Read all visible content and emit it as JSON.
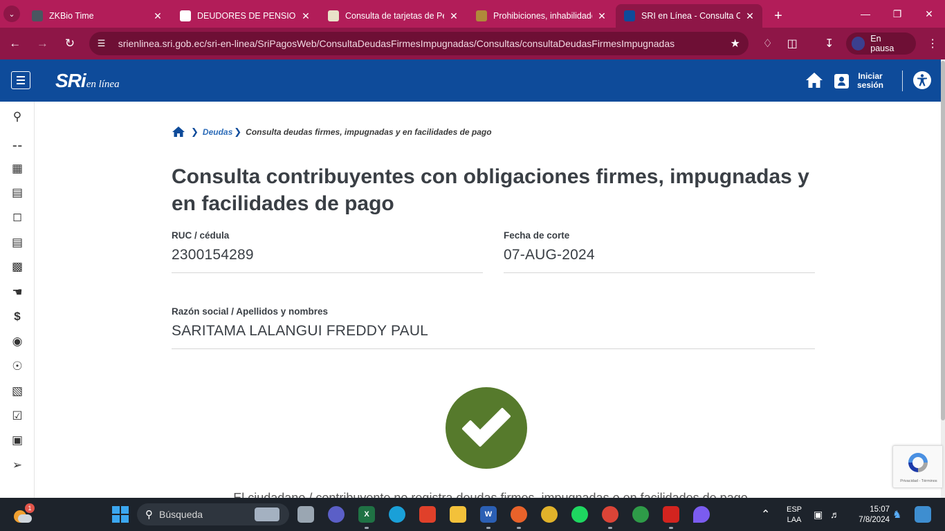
{
  "browser": {
    "tabs": [
      {
        "title": "ZKBio Time",
        "favicon": "zkbio-favicon",
        "color": "#4a5660",
        "active": false
      },
      {
        "title": "DEUDORES DE PENSIONES A",
        "favicon": "google-favicon",
        "color": "#ffffff",
        "active": false
      },
      {
        "title": "Consulta de tarjetas de Pens",
        "favicon": "gov-favicon",
        "color": "#e9e2c8",
        "active": false
      },
      {
        "title": "Prohibiciones, inhabilidades",
        "favicon": "seal-favicon",
        "color": "#b08a3a",
        "active": false
      },
      {
        "title": "SRI en Línea - Consulta Cont",
        "favicon": "sri-favicon",
        "color": "#0e4b9a",
        "active": true
      }
    ],
    "url": "srienlinea.sri.gob.ec/sri-en-linea/SriPagosWeb/ConsultaDeudasFirmesImpugnadas/Consultas/consultaDeudasFirmesImpugnadas",
    "profile_label": "En pausa"
  },
  "site": {
    "logo_main": "SRi",
    "logo_sub": "en línea",
    "login_label": "Iniciar sesión",
    "colors": {
      "header": "#0e4b9a",
      "success": "#567a2c"
    }
  },
  "breadcrumb": {
    "items": [
      "Deudas",
      "Consulta deudas firmes, impugnadas y en facilidades de pago"
    ]
  },
  "page": {
    "title": "Consulta contribuyentes con obligaciones firmes, impugnadas y en facilidades de pago",
    "fields": {
      "ruc": {
        "label": "RUC / cédula",
        "value": "2300154289"
      },
      "fecha": {
        "label": "Fecha de corte",
        "value": "07-AUG-2024"
      },
      "razon": {
        "label": "Razón social / Apellidos y nombres",
        "value": "SARITAMA LALANGUI FREDDY PAUL"
      }
    },
    "result_text": "El ciudadano / contribuyente no registra deudas firmes, impugnadas o en facilidades de pago"
  },
  "recaptcha": {
    "text": "Privacidad - Términos"
  },
  "sidebar": {
    "icons": [
      "search-icon",
      "key-icon",
      "building-icon",
      "cash-register-icon",
      "laptop-icon",
      "document-list-icon",
      "document-icon",
      "hand-tag-icon",
      "dollar-icon",
      "coin-icon",
      "hand-money-icon",
      "receipt-icon",
      "checklist-icon",
      "car-icon",
      "arrow-right-icon"
    ]
  },
  "taskbar": {
    "search_placeholder": "Búsqueda",
    "weather_badge": "1",
    "lang_line1": "ESP",
    "lang_line2": "LAA",
    "time": "15:07",
    "date": "7/8/2024"
  }
}
